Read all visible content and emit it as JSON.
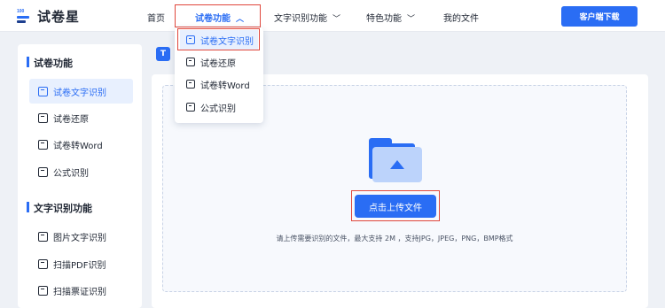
{
  "brand": {
    "logo_number": "100",
    "name": "试卷星"
  },
  "nav": {
    "home": "首页",
    "paper_features": "试卷功能",
    "text_ocr": "文字识别功能",
    "special": "特色功能",
    "my_files": "我的文件",
    "client_download": "客户端下载"
  },
  "dropdown": {
    "items": [
      "试卷文字识别",
      "试卷还原",
      "试卷转Word",
      "公式识别"
    ]
  },
  "sidebar": {
    "section1": "试卷功能",
    "section1_items": [
      "试卷文字识别",
      "试卷还原",
      "试卷转Word",
      "公式识别"
    ],
    "section2": "文字识别功能",
    "section2_items": [
      "图片文字识别",
      "扫描PDF识别",
      "扫描票证识别"
    ]
  },
  "main": {
    "badge": "T",
    "upload_label": "点击上传文件",
    "hint": "请上传需要识别的文件，最大支持 2M ，支持JPG，JPEG，PNG，BMP格式"
  },
  "colors": {
    "accent": "#2a6df4",
    "highlight": "#e0473c"
  }
}
